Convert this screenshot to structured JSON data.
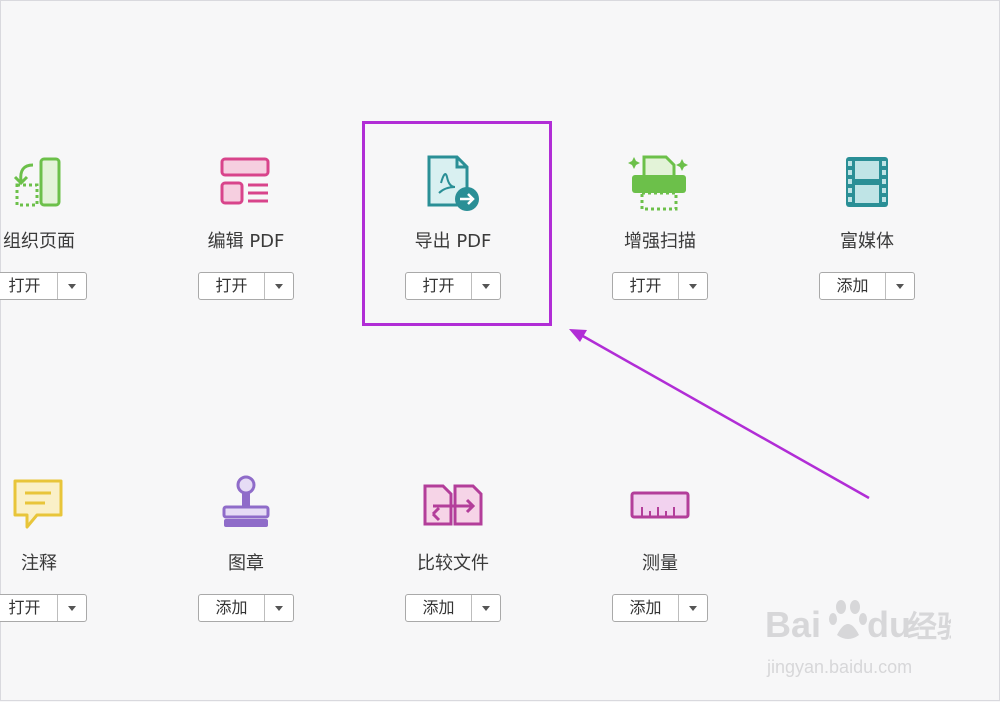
{
  "tools_row1": [
    {
      "label": "组织页面",
      "button": "打开",
      "icon": "organize-pages-icon"
    },
    {
      "label": "编辑 PDF",
      "button": "打开",
      "icon": "edit-pdf-icon"
    },
    {
      "label": "导出 PDF",
      "button": "打开",
      "icon": "export-pdf-icon"
    },
    {
      "label": "增强扫描",
      "button": "打开",
      "icon": "enhance-scan-icon"
    },
    {
      "label": "富媒体",
      "button": "添加",
      "icon": "rich-media-icon"
    }
  ],
  "tools_row2": [
    {
      "label": "注释",
      "button": "打开",
      "icon": "comment-icon"
    },
    {
      "label": "图章",
      "button": "添加",
      "icon": "stamp-icon"
    },
    {
      "label": "比较文件",
      "button": "添加",
      "icon": "compare-files-icon"
    },
    {
      "label": "测量",
      "button": "添加",
      "icon": "measure-icon"
    }
  ],
  "watermark": {
    "brand": "Bai",
    "brand2": "du",
    "cn": "经验",
    "url": "jingyan.baidu.com"
  },
  "colors": {
    "highlight": "#b12dd6",
    "green": "#6cc04a",
    "pink": "#d8448b",
    "teal": "#2a8f96",
    "yellow": "#e8c53a",
    "purple": "#8f6cc9",
    "magenta": "#b33e9a"
  }
}
